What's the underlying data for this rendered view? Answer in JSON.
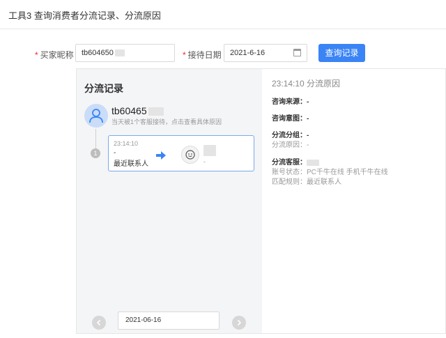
{
  "page": {
    "title": "工具3 查询消费者分流记录、分流原因"
  },
  "form": {
    "buyer_label": "买家昵称",
    "buyer_value": "tb604650",
    "date_label": "接待日期",
    "date_value": "2021-6-16",
    "query_button": "查询记录",
    "required_mark": "*"
  },
  "left": {
    "title": "分流记录",
    "user_name": "tb60465",
    "user_sub": "当天被1个客服接待，点击查看具体原因",
    "timeline_index": "1",
    "card": {
      "time": "23:14:10",
      "dash": "-",
      "reason": "最近联系人",
      "agent_dash": "-"
    },
    "pager_date": "2021-06-16"
  },
  "right": {
    "header": "23:14:10 分流原因",
    "source_label": "咨询来源：",
    "source_value": "-",
    "intent_label": "咨询意图：",
    "intent_value": "-",
    "group_label": "分流分组：",
    "group_value": "-",
    "reason_label": "分流原因：",
    "reason_value": "-",
    "agent_label": "分流客服：",
    "account_label": "账号状态：",
    "account_value": "PC千牛在线 手机千牛在线",
    "match_label": "匹配规则：",
    "match_value": "最近联系人"
  },
  "colors": {
    "primary": "#3b84f5",
    "required": "#f5222d",
    "avatar_bg": "#c9dcf8"
  },
  "icons": [
    "user-icon",
    "arrow-right-icon",
    "smile-face-icon",
    "calendar-icon",
    "chevron-left-icon",
    "chevron-right-icon"
  ]
}
